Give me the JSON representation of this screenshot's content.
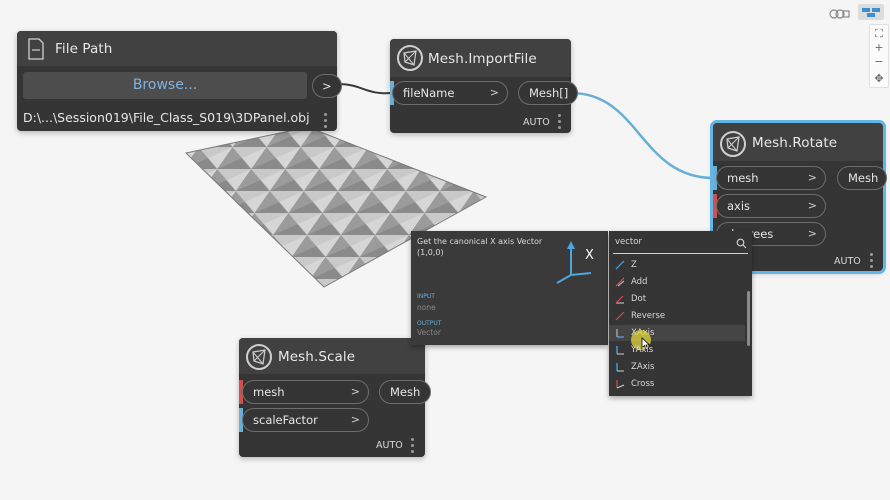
{
  "canvas": {
    "top_controls": [
      "geometry-view-icon",
      "node-view-icon"
    ],
    "zoom_controls": [
      "fit-icon",
      "zoom-in-icon",
      "zoom-out-icon",
      "pan-icon"
    ],
    "wire_color": "#6aaed6"
  },
  "file_path_node": {
    "title": "File Path",
    "browse_label": "Browse...",
    "path_value": "D:\\...\\Session019\\File_Class_S019\\3DPanel.obj",
    "output_label": ">"
  },
  "import_node": {
    "title": "Mesh.ImportFile",
    "input_label": "fileName",
    "output_label": "Mesh[]",
    "lacing": "AUTO"
  },
  "rotate_node": {
    "title": "Mesh.Rotate",
    "inputs": [
      "mesh",
      "axis",
      "degrees"
    ],
    "visible_degrees_fragment": "es",
    "output_label": "Mesh",
    "lacing": "AUTO",
    "axis_port_color": "#d64d4d"
  },
  "scale_node": {
    "title": "Mesh.Scale",
    "inputs": [
      "mesh",
      "scaleFactor"
    ],
    "output_label": "Mesh",
    "lacing": "AUTO"
  },
  "tooltip": {
    "description": "Get the canonical X axis Vector",
    "value": "(1,0,0)",
    "axis_label": "X",
    "input_header": "INPUT",
    "input_value": "none",
    "output_header": "OUTPUT",
    "output_value": "Vector"
  },
  "search": {
    "query": "vector",
    "results": [
      "Z",
      "Add",
      "Dot",
      "Reverse",
      "XAxis",
      "YAxis",
      "ZAxis",
      "Cross"
    ],
    "highlighted": "XAxis"
  }
}
